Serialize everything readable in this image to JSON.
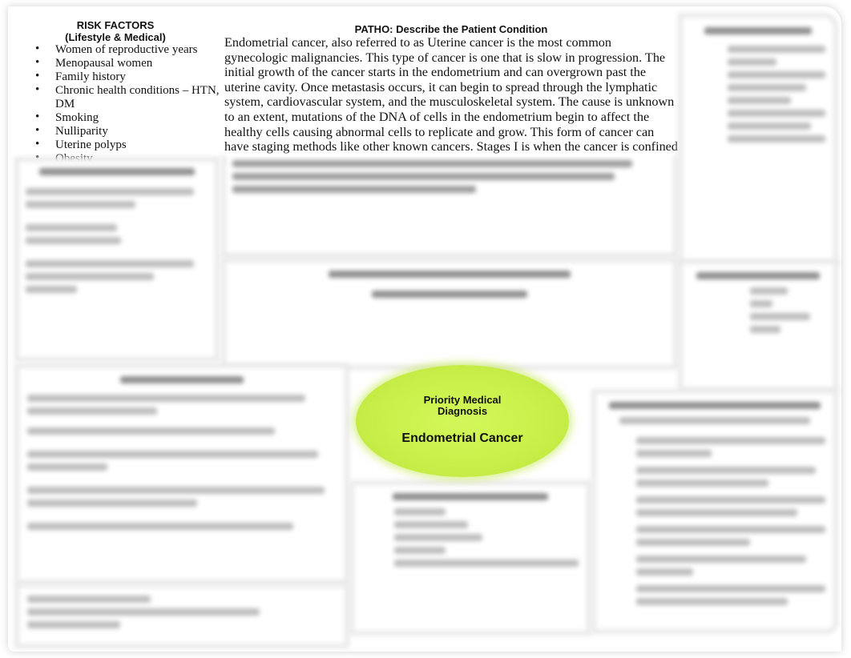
{
  "risk_factors": {
    "title": "RISK FACTORS",
    "subtitle": "(Lifestyle & Medical)",
    "items": [
      "Women of reproductive years",
      "Menopausal women",
      "Family history",
      "Chronic health conditions – HTN, DM",
      "Smoking",
      "Nulliparity",
      "Uterine polyps",
      "Obesity"
    ],
    "bullet_glyph": "•"
  },
  "patho": {
    "title": "PATHO:  Describe the Patient Condition",
    "text": "Endometrial cancer, also referred to as Uterine cancer is the most common gynecologic malignancies. This type of cancer is one that is slow in progression. The initial growth of the cancer starts in the endometrium and can overgrown past the uterine cavity. Once metastasis occurs, it can begin to spread through the lymphatic system, cardiovascular system, and the musculoskeletal system. The cause is unknown to an extent, mutations of the DNA of cells in the endometrium begin to affect the healthy cells causing abnormal cells to replicate and grow. This form of cancer can have staging methods like other known cancers. Stages I is when the cancer is confined to"
  },
  "priority_diagnosis": {
    "label": "Priority Medical Diagnosis",
    "diagnosis": "Endometrial Cancer",
    "fill_color": "#ccf24e"
  },
  "obscured_sections_note": "Remaining concept-map boxes are blurred (unreadable)"
}
